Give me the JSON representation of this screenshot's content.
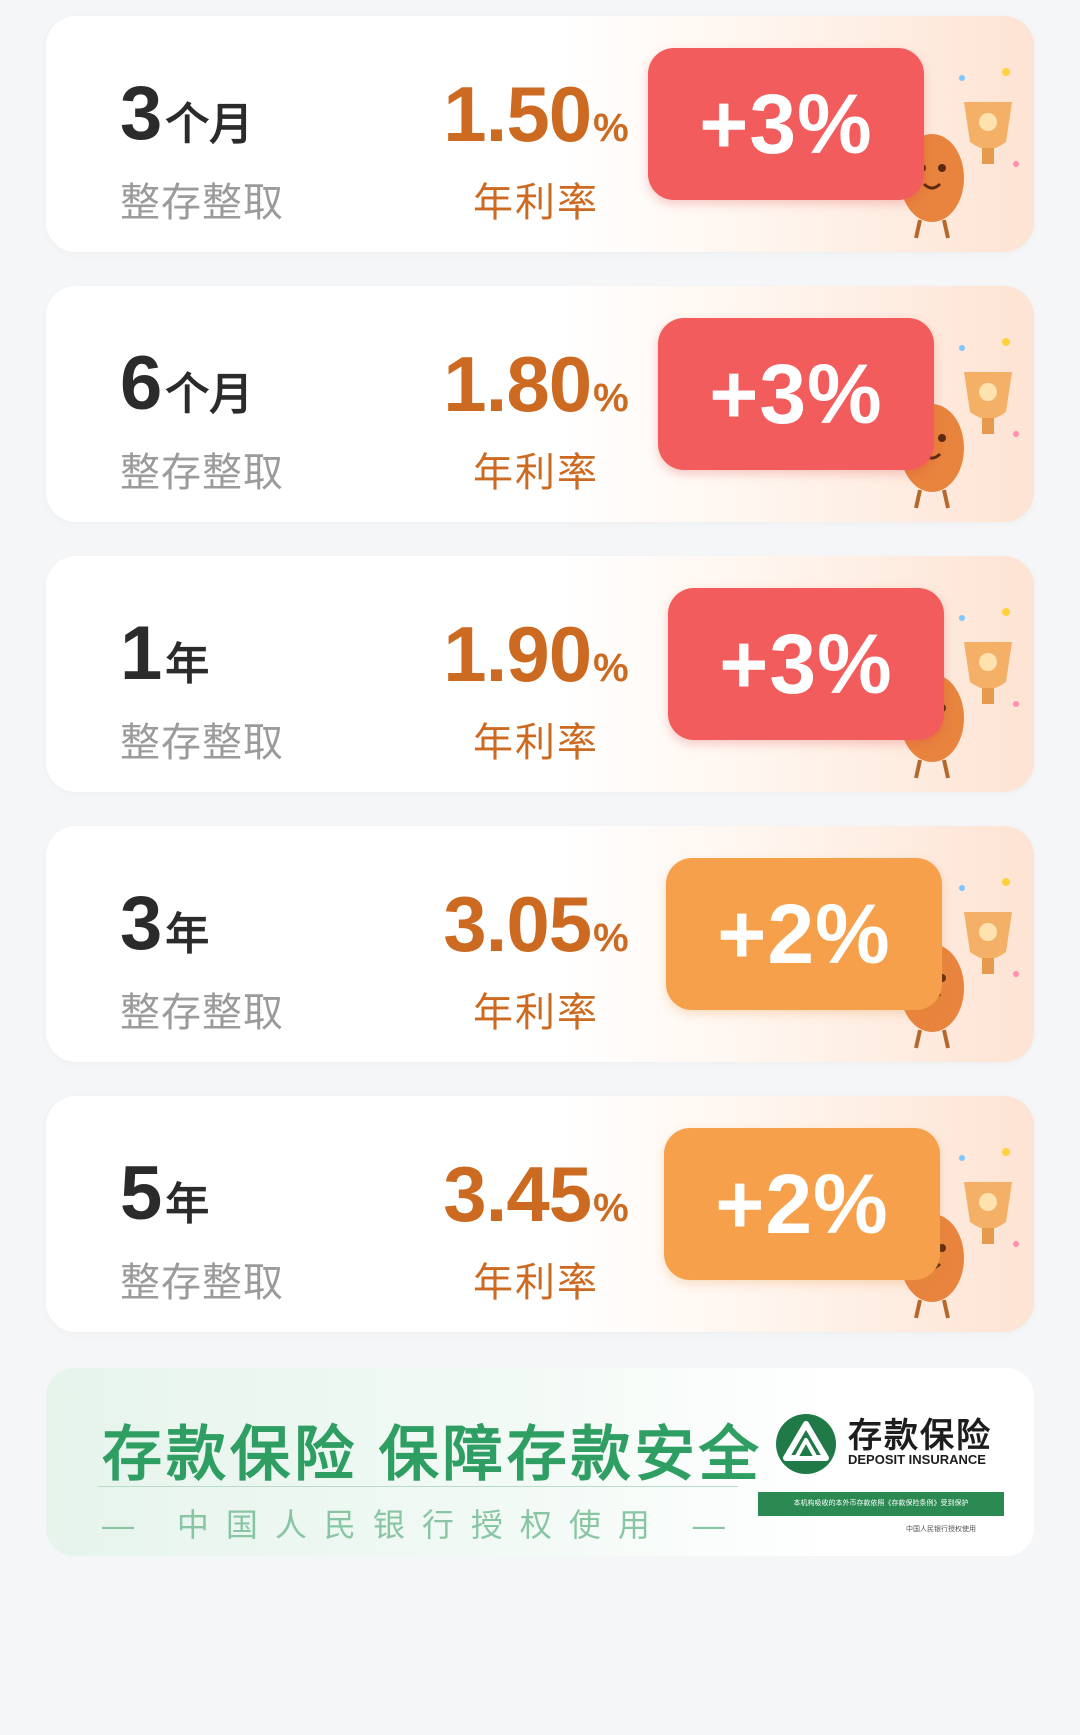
{
  "products": [
    {
      "term_num": "3",
      "term_unit": "个月",
      "type": "整存整取",
      "rate": "1.50",
      "rate_unit": "%",
      "rate_label": "年利率",
      "bonus": "+3%",
      "bonus_color": "#f25c5c"
    },
    {
      "term_num": "6",
      "term_unit": "个月",
      "type": "整存整取",
      "rate": "1.80",
      "rate_unit": "%",
      "rate_label": "年利率",
      "bonus": "+3%",
      "bonus_color": "#f25c5c"
    },
    {
      "term_num": "1",
      "term_unit": "年",
      "type": "整存整取",
      "rate": "1.90",
      "rate_unit": "%",
      "rate_label": "年利率",
      "bonus": "+3%",
      "bonus_color": "#f25c5c"
    },
    {
      "term_num": "3",
      "term_unit": "年",
      "type": "整存整取",
      "rate": "3.05",
      "rate_unit": "%",
      "rate_label": "年利率",
      "bonus": "+2%",
      "bonus_color": "#f7a04b"
    },
    {
      "term_num": "5",
      "term_unit": "年",
      "type": "整存整取",
      "rate": "3.45",
      "rate_unit": "%",
      "rate_label": "年利率",
      "bonus": "+2%",
      "bonus_color": "#f7a04b"
    }
  ],
  "banner": {
    "title": "存款保险 保障存款安全",
    "subtitle": "— 中国人民银行授权使用 —",
    "logo_cn": "存款保险",
    "logo_en": "DEPOSIT INSURANCE",
    "notice": "本机构吸收的本外币存款依照《存款保险条例》受到保护",
    "authorized": "中国人民银行授权使用"
  },
  "colors": {
    "rate_text": "#cc6a22",
    "badge_red": "#f25c5c",
    "badge_orange": "#f7a04b",
    "banner_green": "#2f9e62"
  }
}
